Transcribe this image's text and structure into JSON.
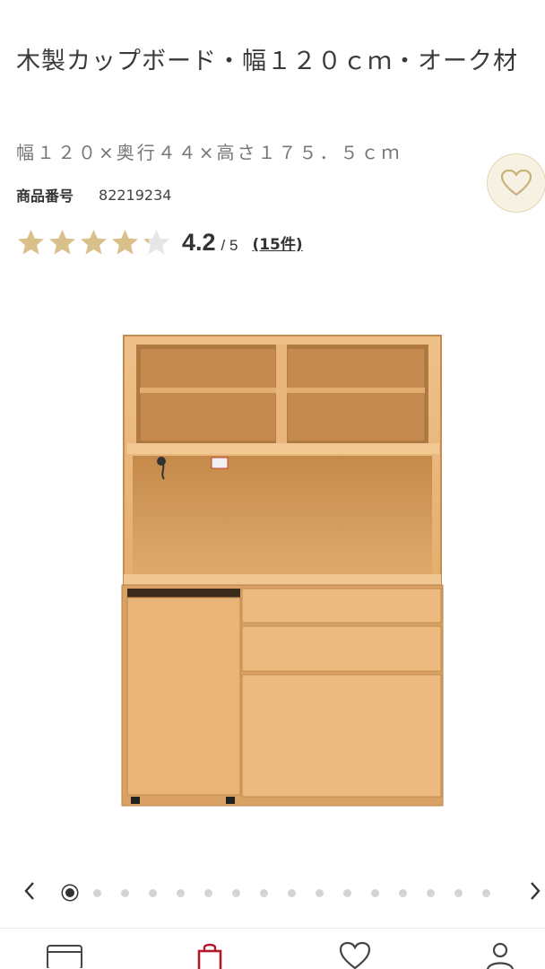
{
  "product": {
    "title": "木製カップボード・幅１２０ｃｍ・オーク材",
    "dimensions": "幅１２０×奥行４４×高さ１７５．５ｃｍ",
    "sku_label": "商品番号",
    "sku_value": "82219234",
    "rating": {
      "score": "4.2",
      "out_of": "/ 5",
      "stars_value": 4.2,
      "stars_max": 5,
      "reviews_link": "(15件)"
    },
    "image": {
      "alt_icon": "cupboard-product-image"
    }
  },
  "favorite_button": {
    "icon": "heart-icon"
  },
  "carousel": {
    "prev_icon": "chevron-left-icon",
    "next_icon": "chevron-right-icon",
    "total_slides": 16,
    "active_index": 0
  },
  "bottom_nav": {
    "items": [
      {
        "icon": "card-icon"
      },
      {
        "icon": "shopping-bag-icon"
      },
      {
        "icon": "heart-icon"
      },
      {
        "icon": "user-icon"
      }
    ]
  },
  "colors": {
    "star_filled": "#d9c08a",
    "star_empty": "#e6e6e6",
    "accent_red": "#b3182a",
    "fav_bg": "#f7f1e4",
    "wood_light": "#e9b77a",
    "wood_dark": "#c98f4f"
  }
}
